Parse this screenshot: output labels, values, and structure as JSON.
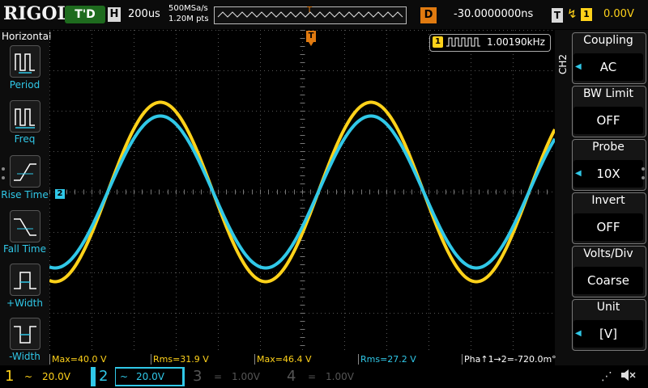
{
  "top": {
    "logo": "RIGOL",
    "trigger_status": "T'D",
    "horizontal_label": "H",
    "timebase": "200us",
    "sample_rate": "500MSa/s",
    "memory_depth": "1.20M pts",
    "delay_label": "D",
    "delay_value": "-30.0000000ns",
    "trigger_label": "T",
    "trigger_source": "1",
    "trigger_level": "0.00V"
  },
  "left_panel": {
    "title": "Horizontal",
    "items": [
      {
        "label": "Period",
        "icon": "period-icon"
      },
      {
        "label": "Freq",
        "icon": "frequency-icon"
      },
      {
        "label": "Rise Time",
        "icon": "rise-time-icon"
      },
      {
        "label": "Fall Time",
        "icon": "fall-time-icon"
      },
      {
        "label": "+Width",
        "icon": "positive-width-icon"
      },
      {
        "label": "-Width",
        "icon": "negative-width-icon"
      }
    ]
  },
  "freq_readout": {
    "channel": "1",
    "value": "1.00190kHz"
  },
  "right_menu": {
    "channel": "CH2",
    "items": [
      {
        "title": "Coupling",
        "value": "AC"
      },
      {
        "title": "BW Limit",
        "value": "OFF"
      },
      {
        "title": "Probe",
        "value": "10X"
      },
      {
        "title": "Invert",
        "value": "OFF"
      },
      {
        "title": "Volts/Div",
        "value": "Coarse"
      },
      {
        "title": "Unit",
        "value": "[V]"
      }
    ]
  },
  "measurements": [
    {
      "text": "Max=40.0 V"
    },
    {
      "text": "Rms=31.9 V"
    },
    {
      "text": "Max=46.4 V"
    },
    {
      "text": "Rms=27.2 V"
    },
    {
      "text": "Pha↑1→2=-720.0m°"
    }
  ],
  "bottom": {
    "ch1": {
      "num": "1",
      "scale": "20.0V"
    },
    "ch2": {
      "num": "2",
      "scale": "20.0V"
    },
    "ch3": {
      "num": "3",
      "scale": "1.00V"
    },
    "ch4": {
      "num": "4",
      "scale": "1.00V"
    }
  },
  "markers": {
    "ch2_ground": "2",
    "trigger_pos": "T"
  },
  "colors": {
    "ch1": "#ffd21a",
    "ch2": "#30c8e8",
    "trigger": "#e07a10",
    "grid": "#555555"
  }
}
